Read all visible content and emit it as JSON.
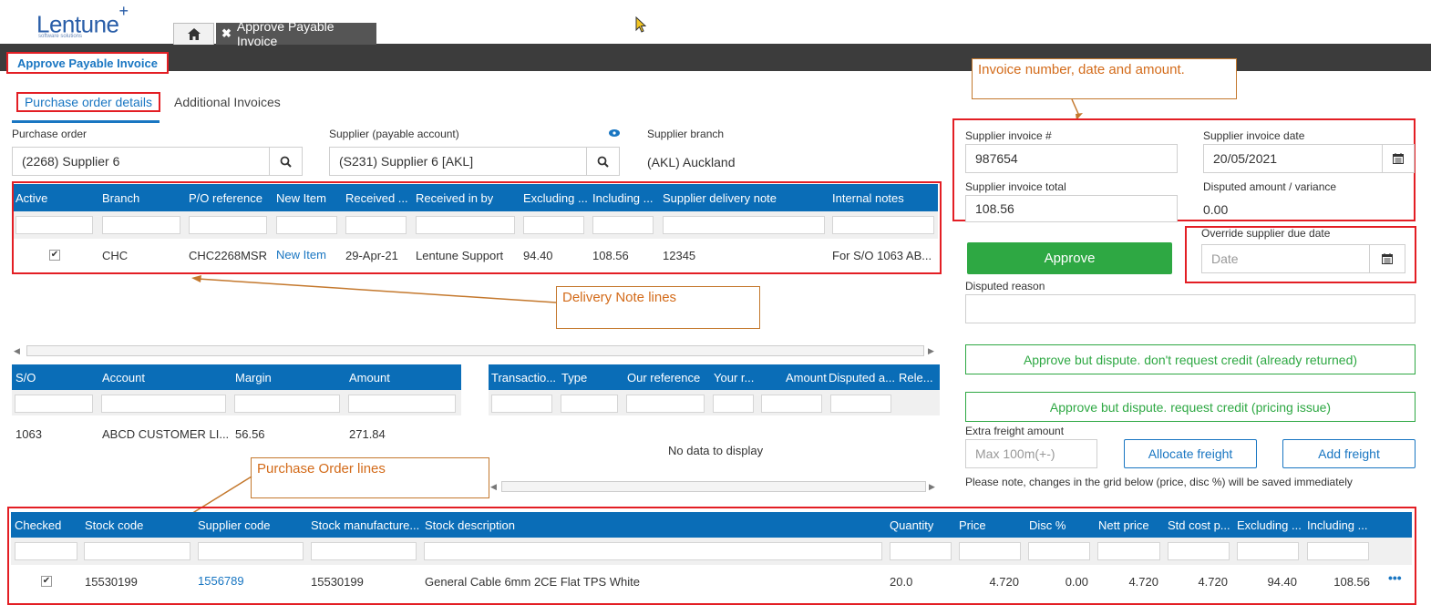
{
  "app": {
    "logo_text": "Lentune",
    "logo_sub": "software solutions",
    "tab_title": "Approve Payable Invoice",
    "page_title": "Approve Payable Invoice"
  },
  "subtabs": [
    "Purchase order details",
    "Additional Invoices"
  ],
  "fields": {
    "purchase_order_label": "Purchase order",
    "purchase_order_value": "(2268) Supplier 6",
    "supplier_label": "Supplier (payable account)",
    "supplier_value": "(S231) Supplier 6 [AKL]",
    "branch_label": "Supplier branch",
    "branch_value": "(AKL) Auckland"
  },
  "delivery_grid": {
    "headers": [
      "Active",
      "Branch",
      "P/O reference",
      "New Item",
      "Received ...",
      "Received in by",
      "Excluding ...",
      "Including ...",
      "Supplier delivery note",
      "Internal notes"
    ],
    "row": {
      "branch": "CHC",
      "po_ref": "CHC2268MSR",
      "new_item": "New Item",
      "received": "29-Apr-21",
      "received_by": "Lentune Support",
      "excluding": "94.40",
      "including": "108.56",
      "delivery_note": "12345",
      "internal_notes": "For S/O 1063 AB..."
    }
  },
  "so_grid": {
    "headers": [
      "S/O",
      "Account",
      "Margin",
      "Amount"
    ],
    "row": {
      "so": "1063",
      "account": "ABCD CUSTOMER LI...",
      "margin": "56.56",
      "amount": "271.84"
    }
  },
  "trans_grid": {
    "headers": [
      "Transactio...",
      "Type",
      "Our reference",
      "Your r...",
      "Amount",
      "Disputed a...",
      "Rele..."
    ],
    "empty_text": "No data to display"
  },
  "invoice": {
    "number_label": "Supplier invoice #",
    "number_value": "987654",
    "date_label": "Supplier invoice date",
    "date_value": "20/05/2021",
    "total_label": "Supplier invoice total",
    "total_value": "108.56",
    "disputed_label": "Disputed amount / variance",
    "disputed_value": "0.00"
  },
  "actions": {
    "approve": "Approve",
    "override_label": "Override supplier due date",
    "override_placeholder": "Date",
    "disputed_reason_label": "Disputed reason",
    "dispute_no_credit": "Approve but dispute. don't request credit (already returned)",
    "dispute_credit": "Approve but dispute. request credit (pricing issue)",
    "extra_freight_label": "Extra freight amount",
    "extra_freight_placeholder": "Max 100m(+-)",
    "allocate_freight": "Allocate freight",
    "add_freight": "Add freight",
    "note": "Please note, changes in the grid below (price, disc %) will be saved immediately"
  },
  "po_lines": {
    "headers": [
      "Checked",
      "Stock code",
      "Supplier code",
      "Stock manufacture...",
      "Stock description",
      "Quantity",
      "Price",
      "Disc %",
      "Nett price",
      "Std cost p...",
      "Excluding ...",
      "Including ..."
    ],
    "row": {
      "stock_code": "15530199",
      "supplier_code": "1556789",
      "manufacturer": "15530199",
      "description": "General Cable 6mm 2CE Flat TPS White",
      "quantity": "20.0",
      "price": "4.720",
      "disc": "0.00",
      "nett": "4.720",
      "std_cost": "4.720",
      "excluding": "94.40",
      "including": "108.56"
    }
  },
  "callouts": {
    "invoice": "Invoice number, date and amount.",
    "delivery": "Delivery Note lines",
    "po_lines": "Purchase Order lines"
  },
  "colors": {
    "accent": "#0a6db7",
    "highlight": "#e31e24",
    "callout": "#c4782d",
    "approve": "#2ea843"
  }
}
